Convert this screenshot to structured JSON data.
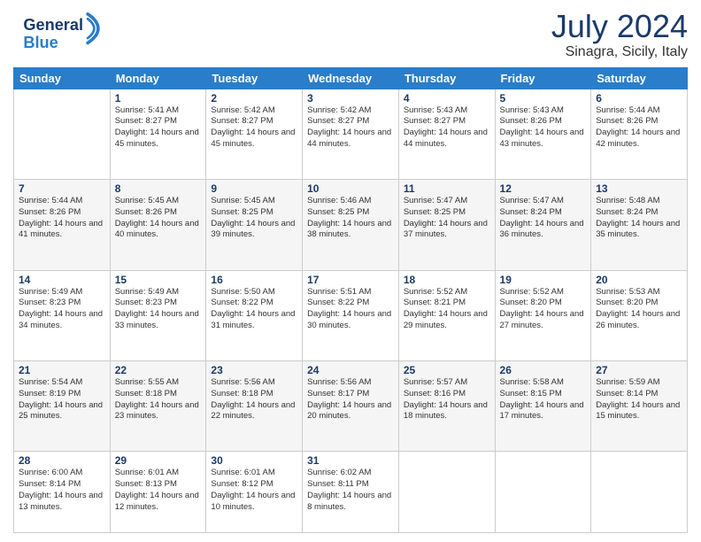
{
  "header": {
    "logo_line1": "General",
    "logo_line2": "Blue",
    "month": "July 2024",
    "location": "Sinagra, Sicily, Italy"
  },
  "weekdays": [
    "Sunday",
    "Monday",
    "Tuesday",
    "Wednesday",
    "Thursday",
    "Friday",
    "Saturday"
  ],
  "weeks": [
    [
      {
        "day": "",
        "sunrise": "",
        "sunset": "",
        "daylight": ""
      },
      {
        "day": "1",
        "sunrise": "Sunrise: 5:41 AM",
        "sunset": "Sunset: 8:27 PM",
        "daylight": "Daylight: 14 hours and 45 minutes."
      },
      {
        "day": "2",
        "sunrise": "Sunrise: 5:42 AM",
        "sunset": "Sunset: 8:27 PM",
        "daylight": "Daylight: 14 hours and 45 minutes."
      },
      {
        "day": "3",
        "sunrise": "Sunrise: 5:42 AM",
        "sunset": "Sunset: 8:27 PM",
        "daylight": "Daylight: 14 hours and 44 minutes."
      },
      {
        "day": "4",
        "sunrise": "Sunrise: 5:43 AM",
        "sunset": "Sunset: 8:27 PM",
        "daylight": "Daylight: 14 hours and 44 minutes."
      },
      {
        "day": "5",
        "sunrise": "Sunrise: 5:43 AM",
        "sunset": "Sunset: 8:26 PM",
        "daylight": "Daylight: 14 hours and 43 minutes."
      },
      {
        "day": "6",
        "sunrise": "Sunrise: 5:44 AM",
        "sunset": "Sunset: 8:26 PM",
        "daylight": "Daylight: 14 hours and 42 minutes."
      }
    ],
    [
      {
        "day": "7",
        "sunrise": "Sunrise: 5:44 AM",
        "sunset": "Sunset: 8:26 PM",
        "daylight": "Daylight: 14 hours and 41 minutes."
      },
      {
        "day": "8",
        "sunrise": "Sunrise: 5:45 AM",
        "sunset": "Sunset: 8:26 PM",
        "daylight": "Daylight: 14 hours and 40 minutes."
      },
      {
        "day": "9",
        "sunrise": "Sunrise: 5:45 AM",
        "sunset": "Sunset: 8:25 PM",
        "daylight": "Daylight: 14 hours and 39 minutes."
      },
      {
        "day": "10",
        "sunrise": "Sunrise: 5:46 AM",
        "sunset": "Sunset: 8:25 PM",
        "daylight": "Daylight: 14 hours and 38 minutes."
      },
      {
        "day": "11",
        "sunrise": "Sunrise: 5:47 AM",
        "sunset": "Sunset: 8:25 PM",
        "daylight": "Daylight: 14 hours and 37 minutes."
      },
      {
        "day": "12",
        "sunrise": "Sunrise: 5:47 AM",
        "sunset": "Sunset: 8:24 PM",
        "daylight": "Daylight: 14 hours and 36 minutes."
      },
      {
        "day": "13",
        "sunrise": "Sunrise: 5:48 AM",
        "sunset": "Sunset: 8:24 PM",
        "daylight": "Daylight: 14 hours and 35 minutes."
      }
    ],
    [
      {
        "day": "14",
        "sunrise": "Sunrise: 5:49 AM",
        "sunset": "Sunset: 8:23 PM",
        "daylight": "Daylight: 14 hours and 34 minutes."
      },
      {
        "day": "15",
        "sunrise": "Sunrise: 5:49 AM",
        "sunset": "Sunset: 8:23 PM",
        "daylight": "Daylight: 14 hours and 33 minutes."
      },
      {
        "day": "16",
        "sunrise": "Sunrise: 5:50 AM",
        "sunset": "Sunset: 8:22 PM",
        "daylight": "Daylight: 14 hours and 31 minutes."
      },
      {
        "day": "17",
        "sunrise": "Sunrise: 5:51 AM",
        "sunset": "Sunset: 8:22 PM",
        "daylight": "Daylight: 14 hours and 30 minutes."
      },
      {
        "day": "18",
        "sunrise": "Sunrise: 5:52 AM",
        "sunset": "Sunset: 8:21 PM",
        "daylight": "Daylight: 14 hours and 29 minutes."
      },
      {
        "day": "19",
        "sunrise": "Sunrise: 5:52 AM",
        "sunset": "Sunset: 8:20 PM",
        "daylight": "Daylight: 14 hours and 27 minutes."
      },
      {
        "day": "20",
        "sunrise": "Sunrise: 5:53 AM",
        "sunset": "Sunset: 8:20 PM",
        "daylight": "Daylight: 14 hours and 26 minutes."
      }
    ],
    [
      {
        "day": "21",
        "sunrise": "Sunrise: 5:54 AM",
        "sunset": "Sunset: 8:19 PM",
        "daylight": "Daylight: 14 hours and 25 minutes."
      },
      {
        "day": "22",
        "sunrise": "Sunrise: 5:55 AM",
        "sunset": "Sunset: 8:18 PM",
        "daylight": "Daylight: 14 hours and 23 minutes."
      },
      {
        "day": "23",
        "sunrise": "Sunrise: 5:56 AM",
        "sunset": "Sunset: 8:18 PM",
        "daylight": "Daylight: 14 hours and 22 minutes."
      },
      {
        "day": "24",
        "sunrise": "Sunrise: 5:56 AM",
        "sunset": "Sunset: 8:17 PM",
        "daylight": "Daylight: 14 hours and 20 minutes."
      },
      {
        "day": "25",
        "sunrise": "Sunrise: 5:57 AM",
        "sunset": "Sunset: 8:16 PM",
        "daylight": "Daylight: 14 hours and 18 minutes."
      },
      {
        "day": "26",
        "sunrise": "Sunrise: 5:58 AM",
        "sunset": "Sunset: 8:15 PM",
        "daylight": "Daylight: 14 hours and 17 minutes."
      },
      {
        "day": "27",
        "sunrise": "Sunrise: 5:59 AM",
        "sunset": "Sunset: 8:14 PM",
        "daylight": "Daylight: 14 hours and 15 minutes."
      }
    ],
    [
      {
        "day": "28",
        "sunrise": "Sunrise: 6:00 AM",
        "sunset": "Sunset: 8:14 PM",
        "daylight": "Daylight: 14 hours and 13 minutes."
      },
      {
        "day": "29",
        "sunrise": "Sunrise: 6:01 AM",
        "sunset": "Sunset: 8:13 PM",
        "daylight": "Daylight: 14 hours and 12 minutes."
      },
      {
        "day": "30",
        "sunrise": "Sunrise: 6:01 AM",
        "sunset": "Sunset: 8:12 PM",
        "daylight": "Daylight: 14 hours and 10 minutes."
      },
      {
        "day": "31",
        "sunrise": "Sunrise: 6:02 AM",
        "sunset": "Sunset: 8:11 PM",
        "daylight": "Daylight: 14 hours and 8 minutes."
      },
      {
        "day": "",
        "sunrise": "",
        "sunset": "",
        "daylight": ""
      },
      {
        "day": "",
        "sunrise": "",
        "sunset": "",
        "daylight": ""
      },
      {
        "day": "",
        "sunrise": "",
        "sunset": "",
        "daylight": ""
      }
    ]
  ]
}
